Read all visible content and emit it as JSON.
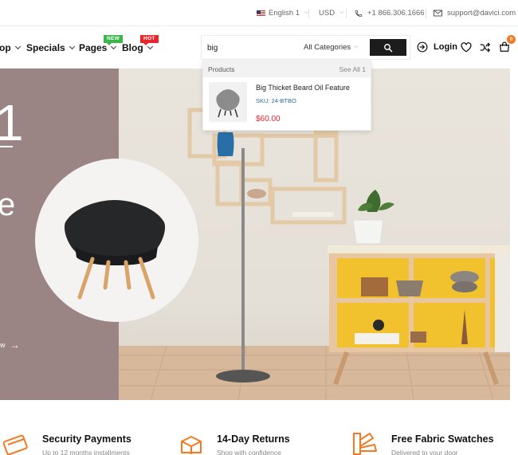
{
  "topbar": {
    "language": "English 1",
    "currency": "USD",
    "phone": "+1 866.306.1666",
    "email": "support@davici.com"
  },
  "nav": {
    "items": [
      {
        "label": "op",
        "has_dropdown": true
      },
      {
        "label": "Specials",
        "has_dropdown": true
      },
      {
        "label": "Pages",
        "has_dropdown": true,
        "badge": "NEW"
      },
      {
        "label": "Blog",
        "has_dropdown": true,
        "badge": "HOT"
      }
    ]
  },
  "search": {
    "value": "big",
    "category": "All Categories"
  },
  "header_actions": {
    "login_label": "Login",
    "cart_count": "0"
  },
  "search_results": {
    "section_label": "Products",
    "see_all_label": "See All 1",
    "items": [
      {
        "name": "Big Thicket Beard Oil Feature",
        "sku": "SKU: 24-BTBO",
        "price": "$60.00"
      }
    ]
  },
  "hero": {
    "numeral": "1",
    "letter": "e",
    "link_text": "w"
  },
  "features": [
    {
      "title": "Security Payments",
      "subtitle": "Up to 12 months installments"
    },
    {
      "title": "14-Day Returns",
      "subtitle": "Shop with confidence"
    },
    {
      "title": "Free Fabric Swatches",
      "subtitle": "Delivered to your door"
    }
  ],
  "colors": {
    "accent": "#f47920",
    "badge_new": "#3cb54a",
    "badge_hot": "#e8262b",
    "price": "#e8262b",
    "hero_left": "#9a8584"
  }
}
